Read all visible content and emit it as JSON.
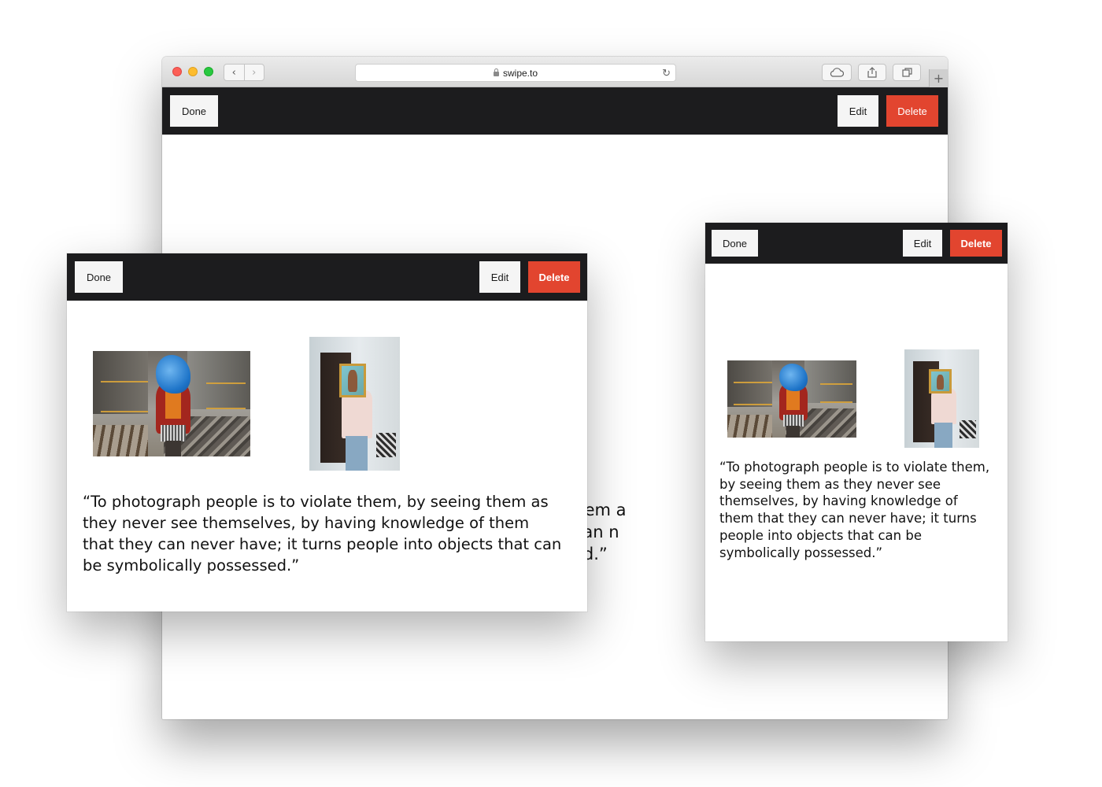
{
  "browser": {
    "url": "swipe.to",
    "nav_back_icon": "chevron-left-icon",
    "nav_forward_icon": "chevron-right-icon"
  },
  "toolbar": {
    "done_label": "Done",
    "edit_label": "Edit",
    "delete_label": "Delete"
  },
  "slide": {
    "quote": "“To photograph people is to violate them, by seeing them as they never see themselves, by having knowledge of them that they can never have; it turns people into objects that can be symbolically possessed.”",
    "background_quote_lines": [
      "y seeing them a",
      "that they can n",
      "y possessed.”"
    ]
  },
  "colors": {
    "toolbar_bg": "#1c1c1e",
    "delete_bg": "#e2452f",
    "button_bg": "#f5f5f5"
  }
}
